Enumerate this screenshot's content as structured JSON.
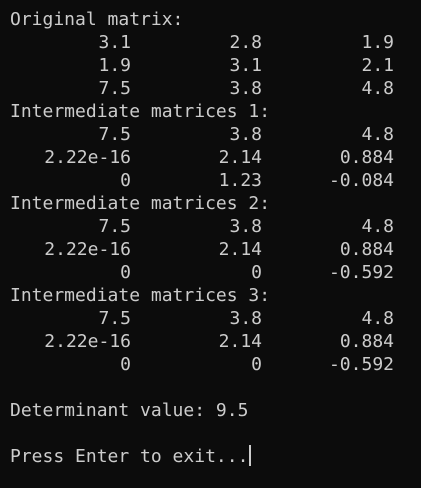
{
  "terminal": {
    "background": "#0c0c0c",
    "foreground": "#cccccc",
    "blocks": [
      {
        "heading": "Original matrix:",
        "rows": [
          [
            "3.1",
            "2.8",
            "1.9"
          ],
          [
            "1.9",
            "3.1",
            "2.1"
          ],
          [
            "7.5",
            "3.8",
            "4.8"
          ]
        ]
      },
      {
        "heading": "Intermediate matrices 1:",
        "rows": [
          [
            "7.5",
            "3.8",
            "4.8"
          ],
          [
            "2.22e-16",
            "2.14",
            "0.884"
          ],
          [
            "0",
            "1.23",
            "-0.084"
          ]
        ]
      },
      {
        "heading": "Intermediate matrices 2:",
        "rows": [
          [
            "7.5",
            "3.8",
            "4.8"
          ],
          [
            "2.22e-16",
            "2.14",
            "0.884"
          ],
          [
            "0",
            "0",
            "-0.592"
          ]
        ]
      },
      {
        "heading": "Intermediate matrices 3:",
        "rows": [
          [
            "7.5",
            "3.8",
            "4.8"
          ],
          [
            "2.22e-16",
            "2.14",
            "0.884"
          ],
          [
            "0",
            "0",
            "-0.592"
          ]
        ]
      }
    ],
    "determinant": "Determinant value: 9.5",
    "prompt": "Press Enter to exit..."
  }
}
